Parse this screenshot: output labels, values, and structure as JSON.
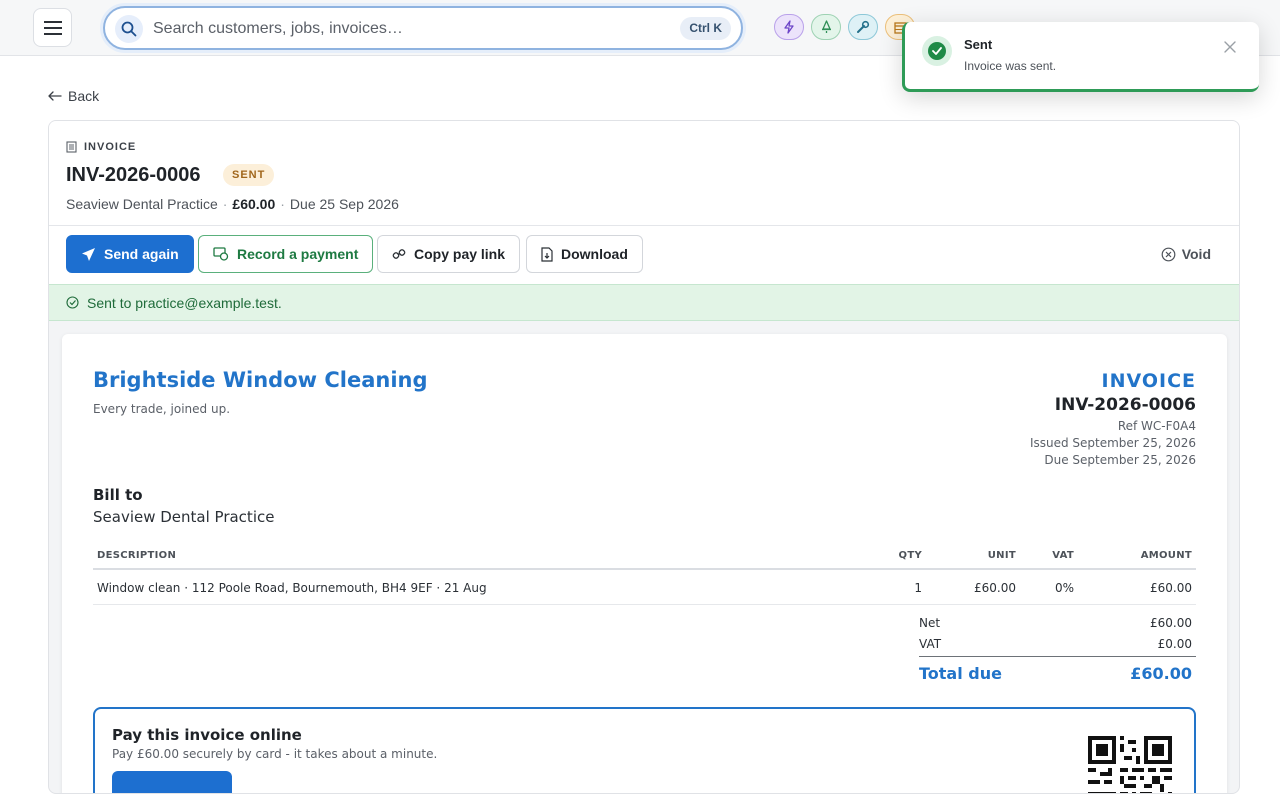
{
  "topbar": {
    "search_placeholder": "Search customers, jobs, invoices…",
    "shortcut": "Ctrl K",
    "quick_actions": [
      "lightning-icon",
      "bell-icon",
      "wrench-icon",
      "calendar-icon"
    ]
  },
  "toast": {
    "title": "Sent",
    "message": "Invoice was sent.",
    "accent": "#2e9b57"
  },
  "nav": {
    "back_label": "Back"
  },
  "invoice_header": {
    "eyebrow": "INVOICE",
    "number": "INV-2026-0006",
    "status": "SENT",
    "customer": "Seaview Dental Practice",
    "amount": "£60.00",
    "due": "Due 25 Sep 2026"
  },
  "actions": {
    "send_again": "Send again",
    "record_payment": "Record a payment",
    "copy_pay_link": "Copy pay link",
    "download": "Download",
    "void": "Void"
  },
  "notice": {
    "text": "Sent to practice@example.test."
  },
  "document": {
    "business_name": "Brightside Window Cleaning",
    "tagline": "Every trade, joined up.",
    "label": "INVOICE",
    "number": "INV-2026-0006",
    "ref": "Ref WC-F0A4",
    "issued": "Issued September 25, 2026",
    "due": "Due September 25, 2026",
    "bill_to_heading": "Bill to",
    "bill_to_name": "Seaview Dental Practice",
    "columns": [
      "DESCRIPTION",
      "QTY",
      "UNIT",
      "VAT",
      "AMOUNT"
    ],
    "lines": [
      {
        "description": "Window clean · 112 Poole Road, Bournemouth, BH4 9EF · 21 Aug",
        "qty": "1",
        "unit": "£60.00",
        "vat": "0%",
        "amount": "£60.00"
      }
    ],
    "totals": {
      "net_label": "Net",
      "net": "£60.00",
      "vat_label": "VAT",
      "vat": "£0.00",
      "due_label": "Total due",
      "due": "£60.00"
    },
    "pay_online": {
      "title": "Pay this invoice online",
      "subtitle": "Pay £60.00 securely by card - it takes about a minute."
    }
  },
  "colors": {
    "primary": "#1d6fd0",
    "brand_blue": "#2274c9",
    "success": "#1e7a42",
    "status_sent_bg": "#fcefd9"
  }
}
